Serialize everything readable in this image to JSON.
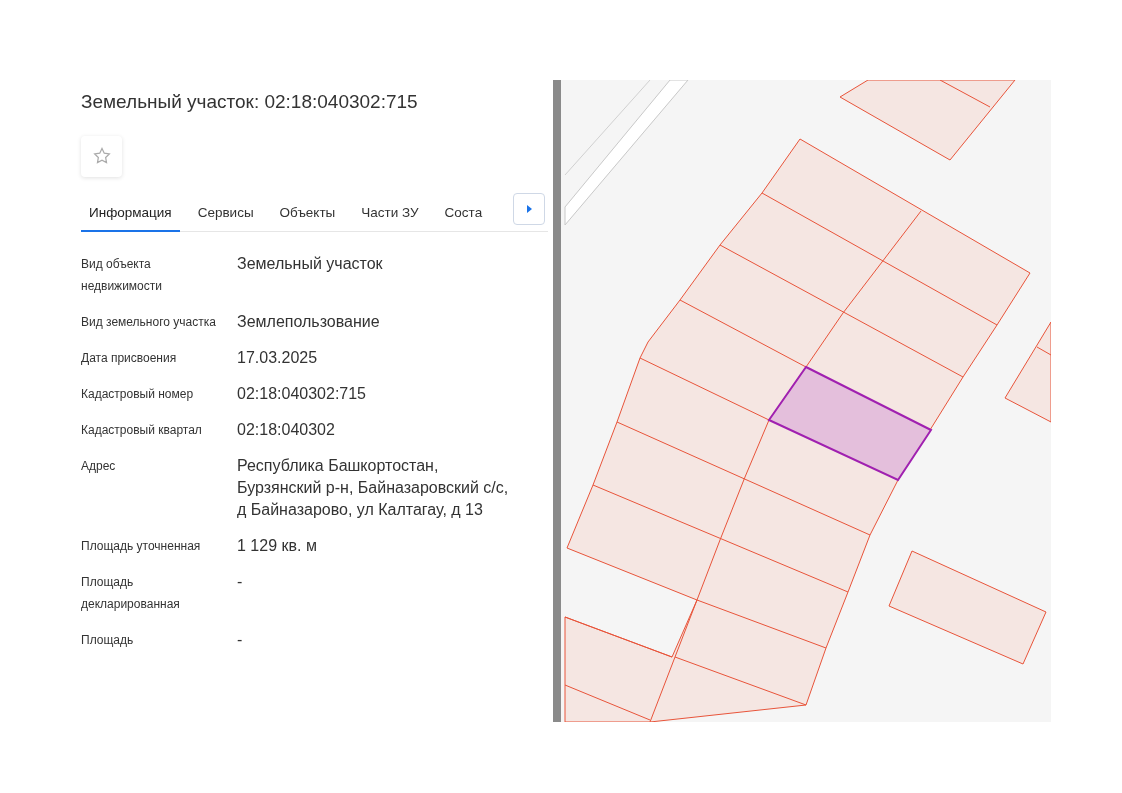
{
  "title": "Земельный участок: 02:18:040302:715",
  "tabs": [
    {
      "label": "Информация",
      "selected": true
    },
    {
      "label": "Сервисы",
      "selected": false
    },
    {
      "label": "Объекты",
      "selected": false
    },
    {
      "label": "Части ЗУ",
      "selected": false
    },
    {
      "label": "Соста",
      "selected": false
    }
  ],
  "fields": [
    {
      "label": "Вид объекта недвижимости",
      "value": "Земельный участок"
    },
    {
      "label": "Вид земельного участка",
      "value": "Землепользование"
    },
    {
      "label": "Дата присвоения",
      "value": "17.03.2025"
    },
    {
      "label": "Кадастровый номер",
      "value": "02:18:040302:715"
    },
    {
      "label": "Кадастровый квартал",
      "value": "02:18:040302"
    },
    {
      "label": "Адрес",
      "value": "Республика Башкортостан, Бурзянский р-н, Байназаровский с/с, д Байназарово, ул Калтагау, д 13"
    },
    {
      "label": "Площадь уточненная",
      "value": "1 129 кв. м"
    },
    {
      "label": "Площадь декларированная",
      "value": "-"
    },
    {
      "label": "Площадь",
      "value": "-"
    }
  ]
}
